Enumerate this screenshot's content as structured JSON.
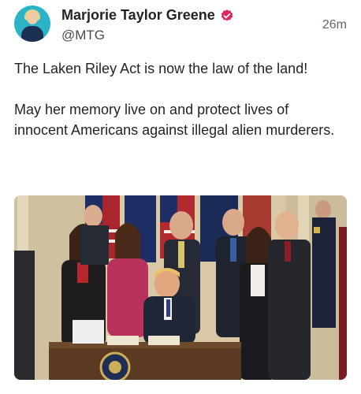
{
  "author": {
    "display_name": "Marjorie Taylor Greene",
    "handle": "@MTG",
    "verified_icon": "verified-check-badge-icon",
    "badge_color": "#e0245e"
  },
  "post": {
    "timestamp": "26m",
    "paragraphs": [
      "The Laken Riley Act is now the law of the land!",
      "May her memory live on and protect lives of innocent Americans against illegal alien murderers."
    ]
  },
  "media": {
    "kind": "photo",
    "alt": "Bill signing ceremony photo"
  }
}
